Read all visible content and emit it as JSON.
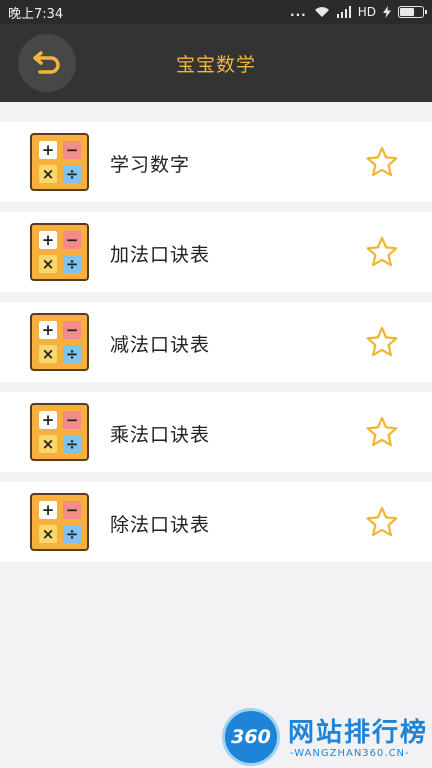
{
  "status_bar": {
    "time": "晚上7:34",
    "dots": "...",
    "network": "HD"
  },
  "header": {
    "title": "宝宝数学",
    "back_icon": "undo-arrow-icon"
  },
  "items": [
    {
      "label": "学习数字"
    },
    {
      "label": "加法口诀表"
    },
    {
      "label": "减法口诀表"
    },
    {
      "label": "乘法口诀表"
    },
    {
      "label": "除法口诀表"
    }
  ],
  "icon_symbols": {
    "plus": "+",
    "minus": "−",
    "times": "×",
    "divide": "÷"
  },
  "watermark": {
    "number": "360",
    "text": "网站排行榜",
    "url": "-WANGZHAN360.CN-"
  },
  "colors": {
    "accent": "#f4b43a",
    "header_bg": "#333333",
    "star": "#f1b52f"
  }
}
